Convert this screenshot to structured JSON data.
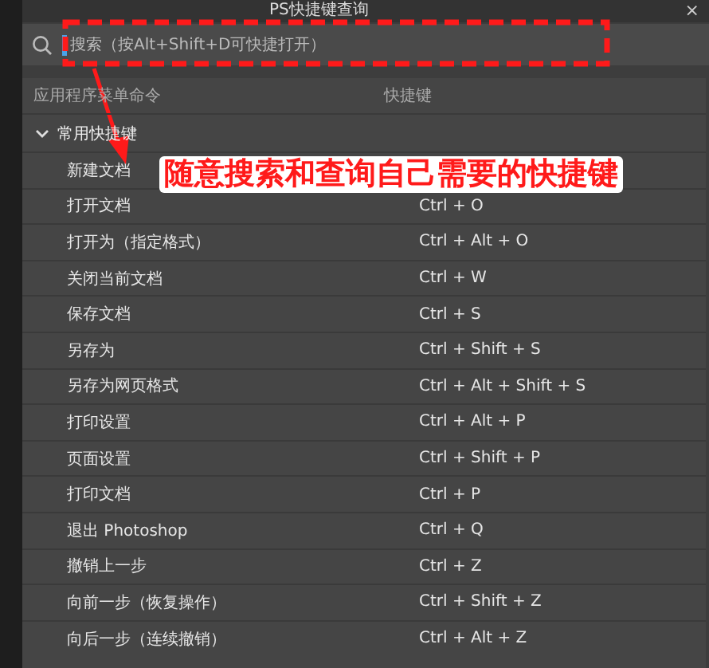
{
  "window": {
    "title": "PS快捷键查询",
    "close": "×"
  },
  "search": {
    "placeholder": "搜索（按Alt+Shift+D可快捷打开）"
  },
  "table": {
    "columns": [
      "应用程序菜单命令",
      "快捷键"
    ],
    "group": {
      "label": "常用快捷键",
      "expanded": true
    },
    "rows": [
      {
        "command": "新建文档",
        "shortcut": ""
      },
      {
        "command": "打开文档",
        "shortcut": "Ctrl + O"
      },
      {
        "command": "打开为（指定格式）",
        "shortcut": "Ctrl + Alt + O"
      },
      {
        "command": "关闭当前文档",
        "shortcut": "Ctrl + W"
      },
      {
        "command": "保存文档",
        "shortcut": "Ctrl + S"
      },
      {
        "command": "另存为",
        "shortcut": "Ctrl + Shift + S"
      },
      {
        "command": "另存为网页格式",
        "shortcut": "Ctrl + Alt + Shift + S"
      },
      {
        "command": "打印设置",
        "shortcut": "Ctrl + Alt + P"
      },
      {
        "command": "页面设置",
        "shortcut": "Ctrl + Shift + P"
      },
      {
        "command": "打印文档",
        "shortcut": "Ctrl + P"
      },
      {
        "command": "退出 Photoshop",
        "shortcut": "Ctrl + Q"
      },
      {
        "command": "撤销上一步",
        "shortcut": "Ctrl + Z"
      },
      {
        "command": "向前一步（恢复操作）",
        "shortcut": "Ctrl + Shift + Z"
      },
      {
        "command": "向后一步（连续撤销）",
        "shortcut": "Ctrl + Alt + Z"
      }
    ]
  },
  "annotation": {
    "caption": "随意搜索和查询自己需要的快捷键"
  }
}
